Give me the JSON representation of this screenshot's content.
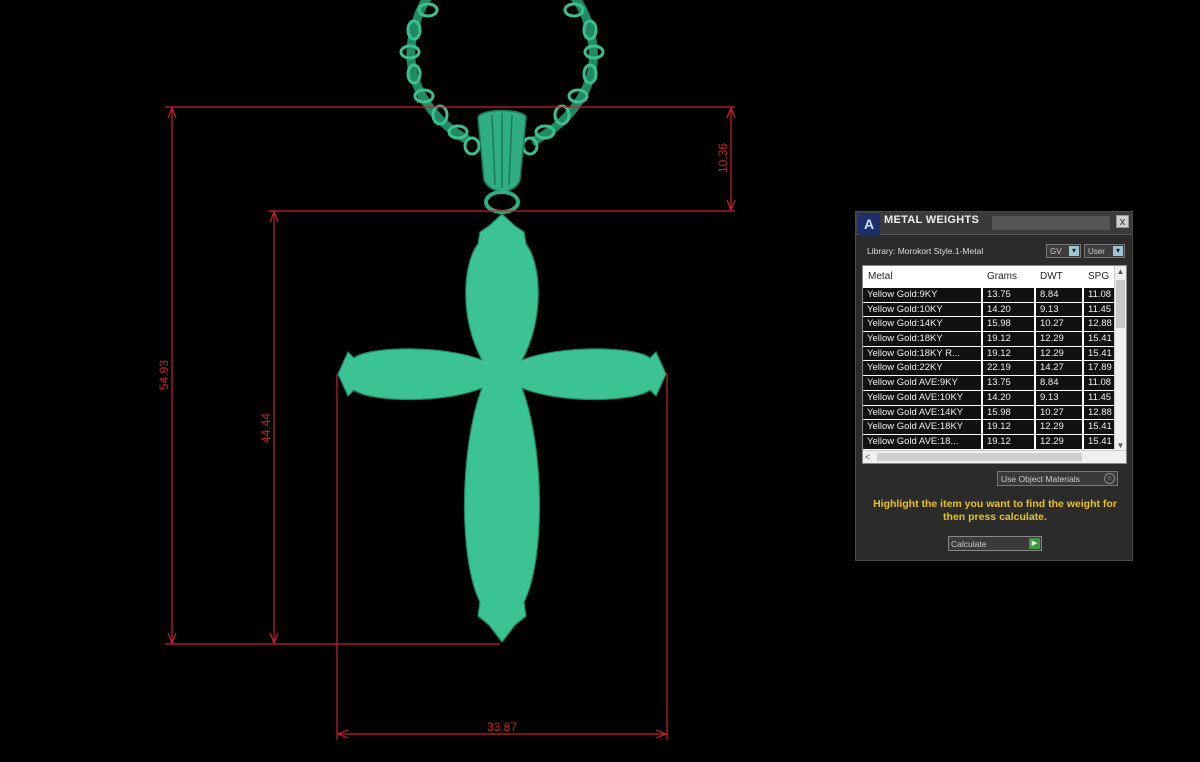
{
  "colors": {
    "background": "#000000",
    "model": "#2fae84",
    "dimension_lines": "#c8202a",
    "panel_bg": "#2b2b2b",
    "hint_text": "#e9c21e"
  },
  "dimensions": {
    "overall_height": "54.93",
    "body_height": "44.44",
    "bail_height": "10.36",
    "width": "33.87"
  },
  "panel": {
    "title": "METAL WEIGHTS",
    "logo_icon": "A",
    "close_icon": "x",
    "library": "Library: Morokort Style.1-Metal",
    "dd1": "GV",
    "dd2": "User",
    "table": {
      "headers": [
        "Metal",
        "Grams",
        "DWT",
        "SPG"
      ],
      "rows": [
        [
          "Yellow Gold:9KY",
          "13.75",
          "8.84",
          "11.08"
        ],
        [
          "Yellow Gold:10KY",
          "14.20",
          "9.13",
          "11.45"
        ],
        [
          "Yellow Gold:14KY",
          "15.98",
          "10.27",
          "12.88"
        ],
        [
          "Yellow Gold:18KY",
          "19.12",
          "12.29",
          "15.41"
        ],
        [
          "Yellow Gold:18KY R...",
          "19.12",
          "12.29",
          "15.41"
        ],
        [
          "Yellow Gold:22KY",
          "22.19",
          "14.27",
          "17.89"
        ],
        [
          "Yellow Gold AVE:9KY",
          "13.75",
          "8.84",
          "11.08"
        ],
        [
          "Yellow Gold AVE:10KY",
          "14.20",
          "9.13",
          "11.45"
        ],
        [
          "Yellow Gold AVE:14KY",
          "15.98",
          "10.27",
          "12.88"
        ],
        [
          "Yellow Gold AVE:18KY",
          "19.12",
          "12.29",
          "15.41"
        ],
        [
          "Yellow Gold AVE:18...",
          "19.12",
          "12.29",
          "15.41"
        ]
      ]
    },
    "object_materials": "Use Object Materials",
    "hint": "Highlight the item you want to find the weight for then press calculate.",
    "calculate": "Calculate"
  }
}
